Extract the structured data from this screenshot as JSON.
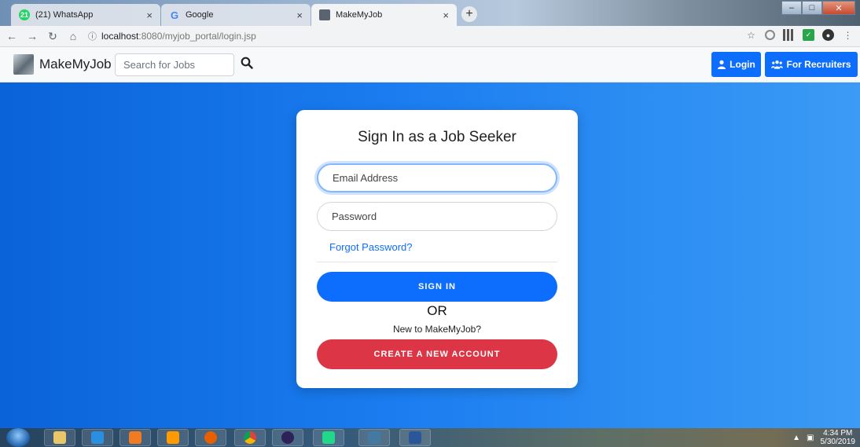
{
  "browser": {
    "tabs": [
      {
        "title": "(21) WhatsApp",
        "badge": "21",
        "icon": "whatsapp-icon"
      },
      {
        "title": "Google",
        "icon": "google-icon"
      },
      {
        "title": "MakeMyJob",
        "icon": "makemyjob-favicon",
        "active": true
      }
    ],
    "close_glyph": "×",
    "newtab_glyph": "+",
    "url": {
      "host": "localhost",
      "path": ":8080/myjob_portal/login.jsp"
    }
  },
  "navbar": {
    "brand": "MakeMyJob",
    "search_placeholder": "Search for Jobs",
    "login_label": "Login",
    "recruiters_label": "For Recruiters"
  },
  "login_card": {
    "title": "Sign In as a Job Seeker",
    "email_placeholder": "Email Address",
    "password_placeholder": "Password",
    "forgot_link": "Forgot Password?",
    "sign_in": "SIGN IN",
    "or": "OR",
    "new_to": "New to MakeMyJob?",
    "create_account": "CREATE A NEW ACCOUNT"
  },
  "taskbar": {
    "time": "4:34 PM",
    "date": "5/30/2019"
  },
  "colors": {
    "primary": "#0d6efd",
    "danger": "#dc3545",
    "hero_start": "#0a63d8",
    "hero_end": "#3b9bf5"
  }
}
